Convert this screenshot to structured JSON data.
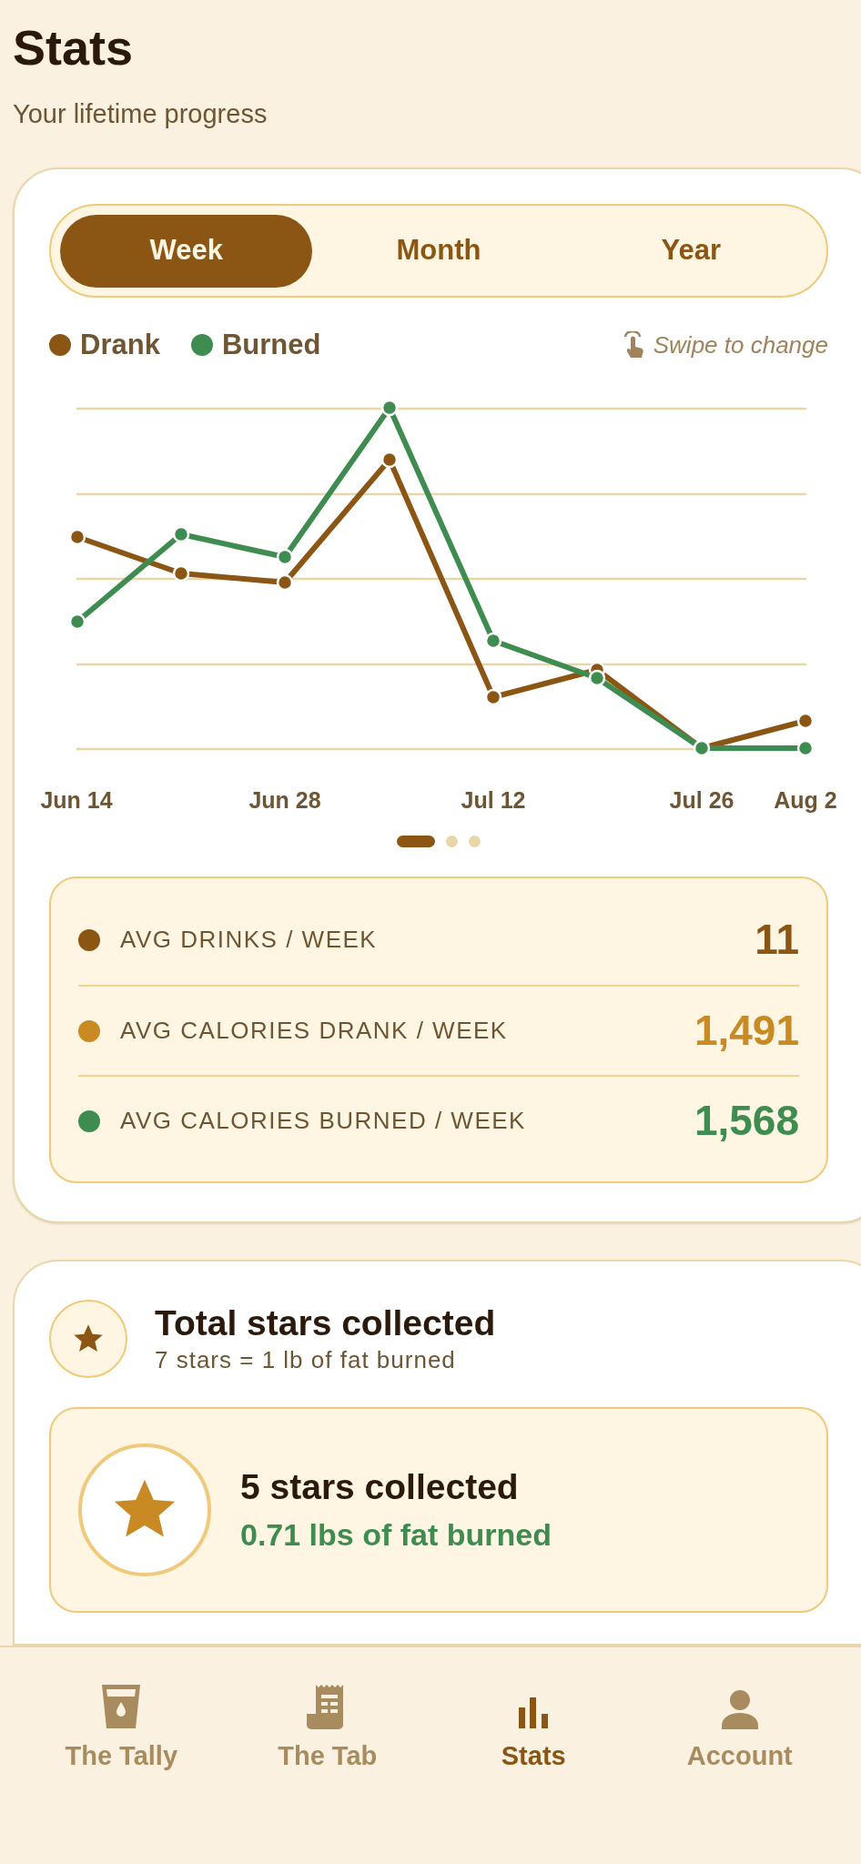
{
  "header": {
    "title": "Stats",
    "subtitle": "Your lifetime progress"
  },
  "tabs": [
    {
      "label": "Week",
      "selected": true
    },
    {
      "label": "Month",
      "selected": false
    },
    {
      "label": "Year",
      "selected": false
    }
  ],
  "legend": [
    {
      "label": "Drank",
      "color": "#8b5614"
    },
    {
      "label": "Burned",
      "color": "#3e8c50"
    }
  ],
  "swipe_hint": "Swipe to change",
  "chart_x_labels": [
    "Jun 14",
    "Jun 28",
    "Jul 12",
    "Jul 26",
    "Aug 2"
  ],
  "pages": [
    {
      "selected": true
    },
    {
      "selected": false
    },
    {
      "selected": false
    }
  ],
  "averages": [
    {
      "label": "AVG DRINKS / WEEK",
      "value": "11",
      "color": "#8b5614"
    },
    {
      "label": "AVG CALORIES DRANK / WEEK",
      "value": "1,491",
      "color": "#c98a24"
    },
    {
      "label": "AVG CALORIES BURNED / WEEK",
      "value": "1,568",
      "color": "#3e8c50"
    }
  ],
  "stars": {
    "title": "Total stars collected",
    "subtitle": "7 stars = 1 lb of fat burned",
    "collected": "5 stars collected",
    "fat_burned": "0.71 lbs of fat burned"
  },
  "nav": [
    {
      "label": "The Tally",
      "kind": "cup",
      "selected": false
    },
    {
      "label": "The Tab",
      "kind": "receipt",
      "selected": false
    },
    {
      "label": "Stats",
      "kind": "chart",
      "selected": true
    },
    {
      "label": "Account",
      "kind": "person",
      "selected": false
    }
  ]
}
